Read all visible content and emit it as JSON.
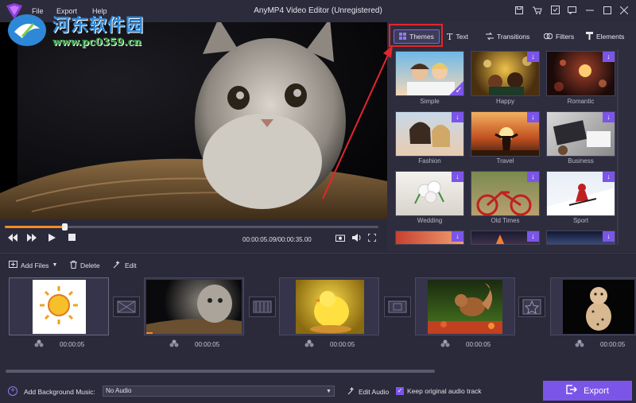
{
  "titlebar": {
    "app_title": "AnyMP4 Video Editor (Unregistered)",
    "menu": [
      "File",
      "Export",
      "Help"
    ],
    "window_buttons": [
      "save-icon",
      "cart-icon",
      "register-icon",
      "feedback-icon",
      "minimize-icon",
      "maximize-icon",
      "close-icon"
    ]
  },
  "watermark": {
    "title": "河东软件园",
    "url": "www.pc0359.cn"
  },
  "player": {
    "timecode": "00:00:05.09/00:00:35.00",
    "progress_fraction": 0.16,
    "controls": [
      "rewind-icon",
      "forward-icon",
      "play-icon",
      "stop-icon",
      "snapshot-icon",
      "volume-icon",
      "fullscreen-icon"
    ]
  },
  "tabs": [
    {
      "label": "Themes",
      "icon": "grid-icon",
      "active": true
    },
    {
      "label": "Text",
      "icon": "text-icon"
    },
    {
      "label": "Transitions",
      "icon": "transitions-icon"
    },
    {
      "label": "Filters",
      "icon": "filters-icon"
    },
    {
      "label": "Elements",
      "icon": "elements-icon"
    }
  ],
  "themes": [
    {
      "label": "Simple",
      "selected": true,
      "download": false
    },
    {
      "label": "Happy",
      "download": true
    },
    {
      "label": "Romantic",
      "download": true
    },
    {
      "label": "Fashion",
      "download": true
    },
    {
      "label": "Travel",
      "download": true
    },
    {
      "label": "Business",
      "download": true
    },
    {
      "label": "Wedding",
      "download": true
    },
    {
      "label": "Old Times",
      "download": true
    },
    {
      "label": "Sport",
      "download": true
    },
    {
      "label": "",
      "download": true
    },
    {
      "label": "",
      "download": true
    },
    {
      "label": "",
      "download": true
    }
  ],
  "toolbar": {
    "add_files": "Add Files",
    "delete": "Delete",
    "edit": "Edit"
  },
  "clips": [
    {
      "name": "sun-drawing",
      "duration": "00:00:05"
    },
    {
      "name": "kitten",
      "duration": "00:00:05"
    },
    {
      "name": "duckling",
      "duration": "00:00:05"
    },
    {
      "name": "squirrel",
      "duration": "00:00:05"
    },
    {
      "name": "cheetah-cub",
      "duration": "00:00:05"
    }
  ],
  "bottombar": {
    "add_bgm": "Add Background Music:",
    "audio_value": "No Audio",
    "edit_audio": "Edit Audio",
    "keep_audio": "Keep original audio track",
    "export": "Export"
  },
  "colors": {
    "accent": "#7b55e8",
    "progress": "#ff8a1f",
    "highlight": "#e3262c",
    "panel": "#2e2d3e"
  }
}
